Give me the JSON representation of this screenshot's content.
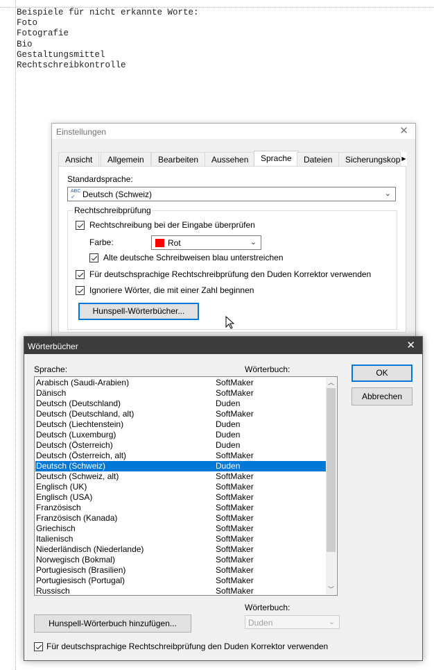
{
  "document": {
    "lines": [
      "Beispiele für nicht erkannte Worte:",
      "Foto",
      "Fotografie",
      "Bio",
      "Gestaltungsmittel",
      "Rechtschreibkontrolle"
    ]
  },
  "settings": {
    "title": "Einstellungen",
    "tabs": [
      "Ansicht",
      "Allgemein",
      "Bearbeiten",
      "Aussehen",
      "Sprache",
      "Dateien",
      "Sicherungskop"
    ],
    "active_tab": "Sprache",
    "standard_language_label": "Standardsprache:",
    "standard_language_value": "Deutsch (Schweiz)",
    "spellcheck_group": "Rechtschreibprüfung",
    "check_on_input": "Rechtschreibung bei der Eingabe überprüfen",
    "color_label": "Farbe:",
    "color_value": "Rot",
    "old_spellings": "Alte deutsche Schreibweisen blau unterstreichen",
    "duden_option": "Für deutschsprachige Rechtschreibprüfung den Duden Korrektor verwenden",
    "ignore_numbers": "Ignoriere Wörter, die mit einer Zahl beginnen",
    "hunspell_button": "Hunspell-Wörterbücher..."
  },
  "dictionaries": {
    "title": "Wörterbücher",
    "col_language": "Sprache:",
    "col_dictionary": "Wörterbuch:",
    "rows": [
      {
        "lang": "Arabisch (Saudi-Arabien)",
        "dict": "SoftMaker"
      },
      {
        "lang": "Dänisch",
        "dict": "SoftMaker"
      },
      {
        "lang": "Deutsch (Deutschland)",
        "dict": "Duden"
      },
      {
        "lang": "Deutsch (Deutschland, alt)",
        "dict": "SoftMaker"
      },
      {
        "lang": "Deutsch (Liechtenstein)",
        "dict": "Duden"
      },
      {
        "lang": "Deutsch (Luxemburg)",
        "dict": "Duden"
      },
      {
        "lang": "Deutsch (Österreich)",
        "dict": "Duden"
      },
      {
        "lang": "Deutsch (Österreich, alt)",
        "dict": "SoftMaker"
      },
      {
        "lang": "Deutsch (Schweiz)",
        "dict": "Duden"
      },
      {
        "lang": "Deutsch (Schweiz, alt)",
        "dict": "SoftMaker"
      },
      {
        "lang": "Englisch (UK)",
        "dict": "SoftMaker"
      },
      {
        "lang": "Englisch (USA)",
        "dict": "SoftMaker"
      },
      {
        "lang": "Französisch",
        "dict": "SoftMaker"
      },
      {
        "lang": "Französisch (Kanada)",
        "dict": "SoftMaker"
      },
      {
        "lang": "Griechisch",
        "dict": "SoftMaker"
      },
      {
        "lang": "Italienisch",
        "dict": "SoftMaker"
      },
      {
        "lang": "Niederländisch (Niederlande)",
        "dict": "SoftMaker"
      },
      {
        "lang": "Norwegisch (Bokmal)",
        "dict": "SoftMaker"
      },
      {
        "lang": "Portugiesisch (Brasilien)",
        "dict": "SoftMaker"
      },
      {
        "lang": "Portugiesisch (Portugal)",
        "dict": "SoftMaker"
      },
      {
        "lang": "Russisch",
        "dict": "SoftMaker"
      }
    ],
    "selected_row": 8,
    "ok_button": "OK",
    "cancel_button": "Abbrechen",
    "add_button": "Hunspell-Wörterbuch hinzufügen...",
    "dictionary_label": "Wörterbuch:",
    "dictionary_value": "Duden",
    "duden_option": "Für deutschsprachige Rechtschreibprüfung den Duden Korrektor verwenden"
  },
  "colors": {
    "accent": "#0078d7",
    "swatch_red": "#ff0000",
    "dialog_titlebar": "#3c3c3c"
  }
}
